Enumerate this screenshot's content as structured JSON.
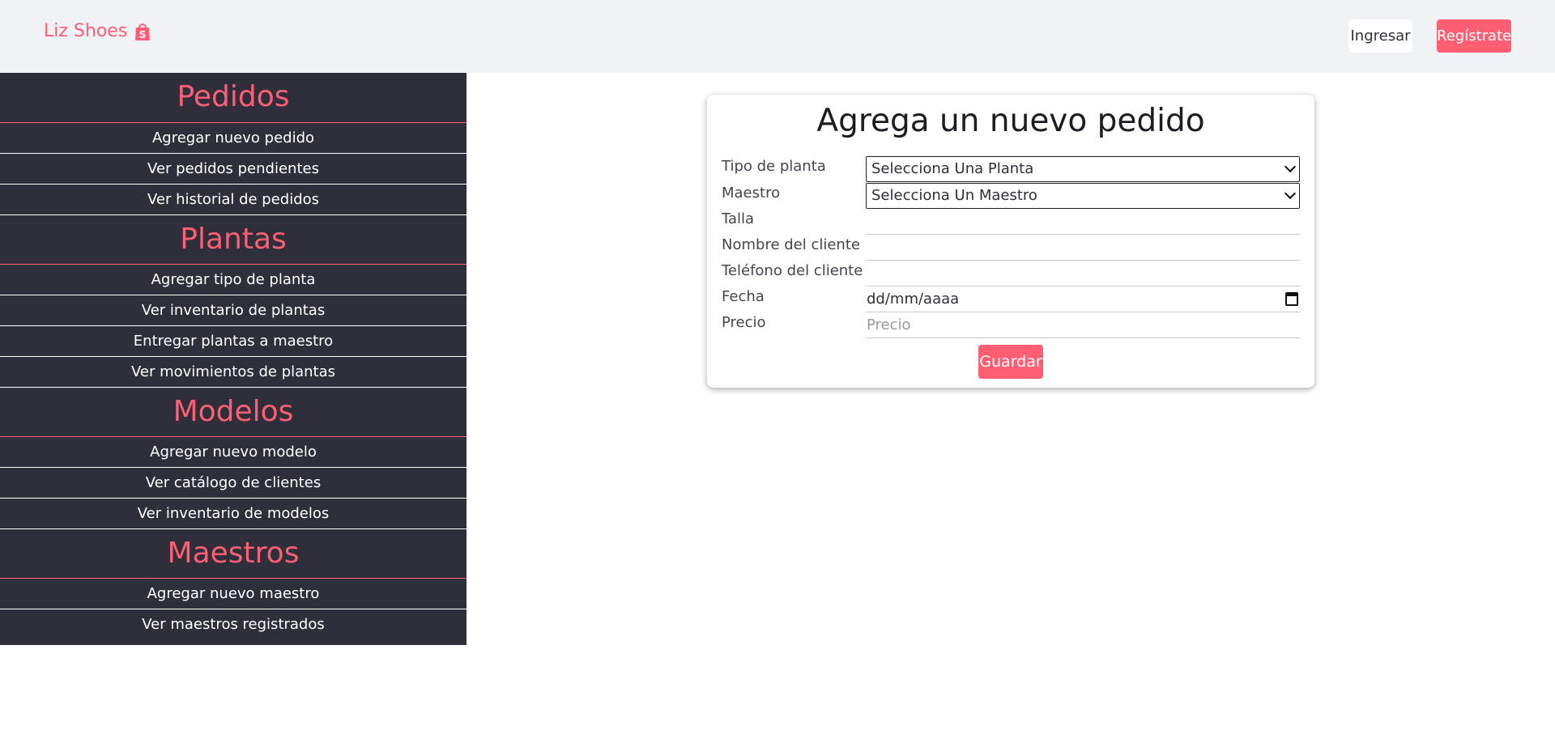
{
  "header": {
    "brand": "Liz Shoes",
    "brand_icon": "shopping-bag-icon",
    "login_label": "Ingresar",
    "register_label": "Regístrate",
    "accent_color": "#ff5e73"
  },
  "sidebar": {
    "sections": [
      {
        "title": "Pedidos",
        "items": [
          "Agregar nuevo pedido",
          "Ver pedidos pendientes",
          "Ver historial de pedidos"
        ]
      },
      {
        "title": "Plantas",
        "items": [
          "Agregar tipo de planta",
          "Ver inventario de plantas",
          "Entregar plantas a maestro",
          "Ver movimientos de plantas"
        ]
      },
      {
        "title": "Modelos",
        "items": [
          "Agregar nuevo modelo",
          "Ver catálogo de clientes",
          "Ver inventario de modelos"
        ]
      },
      {
        "title": "Maestros",
        "items": [
          "Agregar nuevo maestro",
          "Ver maestros registrados"
        ]
      }
    ]
  },
  "form": {
    "title": "Agrega un nuevo pedido",
    "labels": {
      "tipo": "Tipo de planta",
      "maestro": "Maestro",
      "talla": "Talla",
      "nombre": "Nombre del cliente",
      "telefono": "Teléfono del cliente",
      "fecha": "Fecha",
      "precio": "Precio"
    },
    "tipo_value": "Selecciona Una Planta",
    "maestro_value": "Selecciona Un Maestro",
    "talla_value": "",
    "nombre_value": "",
    "telefono_value": "",
    "fecha_placeholder": "dd/mm/aaaa",
    "precio_placeholder": "Precio",
    "save_label": "Guardar"
  }
}
